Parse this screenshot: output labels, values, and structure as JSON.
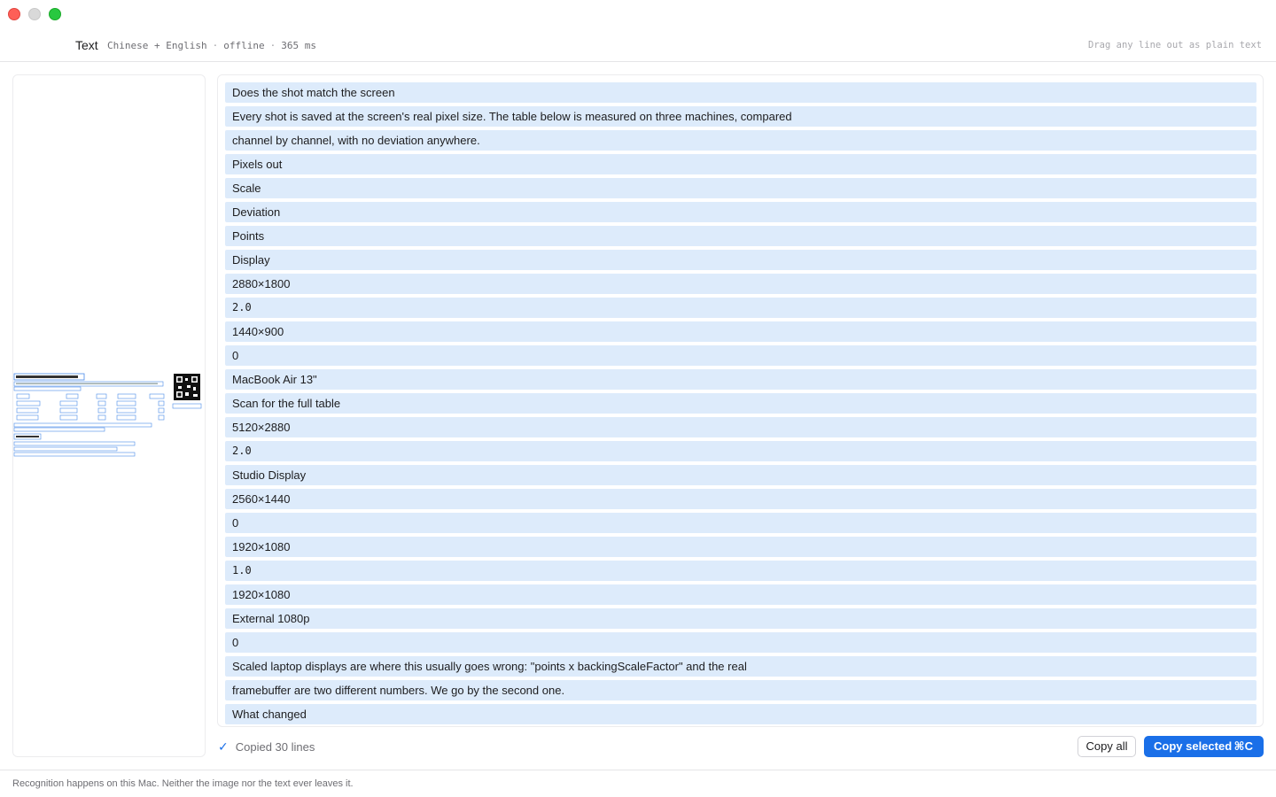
{
  "window": {
    "controls": [
      "close",
      "minimize",
      "maximize"
    ]
  },
  "header": {
    "title": "Text",
    "languages": "Chinese + English",
    "mode": "offline",
    "duration": "365 ms",
    "hint": "Drag any line out as plain text"
  },
  "preview": {
    "thumbnail_icon": "document-thumbnail"
  },
  "lines": [
    {
      "text": "Does the shot match the screen",
      "mono": false
    },
    {
      "text": "Every shot is saved at the screen's real pixel size. The table below is measured on three machines, compared",
      "mono": false
    },
    {
      "text": "channel by channel, with no deviation anywhere.",
      "mono": false
    },
    {
      "text": "Pixels out",
      "mono": false
    },
    {
      "text": "Scale",
      "mono": false
    },
    {
      "text": "Deviation",
      "mono": false
    },
    {
      "text": "Points",
      "mono": false
    },
    {
      "text": "Display",
      "mono": false
    },
    {
      "text": "2880×1800",
      "mono": false
    },
    {
      "text": "2.0",
      "mono": true
    },
    {
      "text": "1440×900",
      "mono": false
    },
    {
      "text": "0",
      "mono": false
    },
    {
      "text": "MacBook Air 13\"",
      "mono": false
    },
    {
      "text": "Scan for the full table",
      "mono": false
    },
    {
      "text": "5120×2880",
      "mono": false
    },
    {
      "text": "2.0",
      "mono": true
    },
    {
      "text": "Studio Display",
      "mono": false
    },
    {
      "text": "2560×1440",
      "mono": false
    },
    {
      "text": "0",
      "mono": false
    },
    {
      "text": "1920×1080",
      "mono": false
    },
    {
      "text": "1.0",
      "mono": true
    },
    {
      "text": "1920×1080",
      "mono": false
    },
    {
      "text": "External 1080p",
      "mono": false
    },
    {
      "text": "0",
      "mono": false
    },
    {
      "text": "Scaled laptop displays are where this usually goes wrong:  \"points x backingScaleFactor\" and the real",
      "mono": false
    },
    {
      "text": "framebuffer are two different numbers. We go by the second one.",
      "mono": false
    },
    {
      "text": "What changed",
      "mono": false
    }
  ],
  "actions": {
    "status_icon": "checkmark-icon",
    "status_text": "Copied 30 lines",
    "copy_all_label": "Copy all",
    "copy_selected_label": "Copy selected",
    "copy_selected_shortcut": "⌘C"
  },
  "footer": {
    "text": "Recognition happens on this Mac. Neither the image nor the text ever leaves it."
  },
  "colors": {
    "accent": "#1a6fe8",
    "line_highlight": "#ddebfb",
    "close": "#fe5f57",
    "maximize": "#28c840"
  }
}
